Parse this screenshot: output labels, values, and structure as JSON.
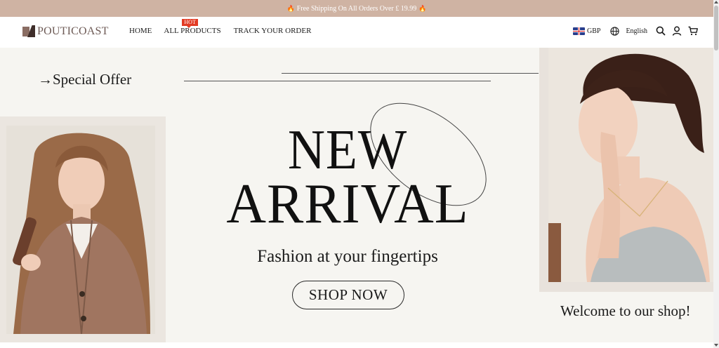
{
  "announcement": {
    "text": "Free Shipping On All Orders Over £ 19.99"
  },
  "header": {
    "logo_text": "POUTICOAST",
    "nav": {
      "home": "HOME",
      "all_products": "ALL PRODUCTS",
      "hot_badge": "HOT",
      "track_order": "TRACK YOUR ORDER"
    },
    "currency": "GBP",
    "language": "English"
  },
  "hero": {
    "special_offer": "→Special Offer",
    "headline_line1": "NEW",
    "headline_line2": "ARRIVAL",
    "tagline": "Fashion at your fingertips",
    "cta_label": "SHOP NOW",
    "welcome": "Welcome to our shop!"
  },
  "icons": {
    "announcement": "flame-icon",
    "currency": "uk-flag-icon",
    "language": "globe-icon",
    "search": "search-icon",
    "account": "user-icon",
    "cart": "cart-icon"
  },
  "colors": {
    "announcement_bar": "#cfb3a3",
    "hot_badge": "#e23b24",
    "hero_background": "#f6f5f1",
    "logo": "#6d5a55"
  }
}
